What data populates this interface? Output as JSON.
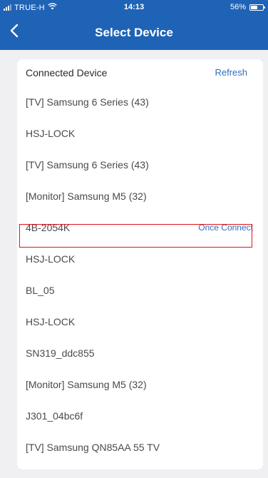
{
  "status_bar": {
    "carrier": "TRUE-H",
    "time": "14:13",
    "battery": "56%",
    "battery_level": 0.56,
    "signal_icon": "signal-icon",
    "wifi_icon": "wifi-icon",
    "battery_icon": "battery-icon"
  },
  "nav": {
    "title": "Select Device",
    "back_icon": "chevron-left-icon"
  },
  "card": {
    "title": "Connected Device",
    "refresh_label": "Refresh"
  },
  "devices": [
    {
      "name": "[TV] Samsung 6 Series (43)",
      "action": ""
    },
    {
      "name": "HSJ-LOCK",
      "action": ""
    },
    {
      "name": "[TV] Samsung 6 Series (43)",
      "action": ""
    },
    {
      "name": "[Monitor] Samsung M5 (32)",
      "action": ""
    },
    {
      "name": "4B-2054K",
      "action": "Once Connect"
    },
    {
      "name": "HSJ-LOCK",
      "action": ""
    },
    {
      "name": "BL_05",
      "action": ""
    },
    {
      "name": "HSJ-LOCK",
      "action": ""
    },
    {
      "name": "SN319_ddc855",
      "action": ""
    },
    {
      "name": "[Monitor] Samsung M5 (32)",
      "action": ""
    },
    {
      "name": "J301_04bc6f",
      "action": ""
    },
    {
      "name": "[TV] Samsung QN85AA 55 TV",
      "action": ""
    }
  ],
  "colors": {
    "header": "#1f63b6",
    "accent": "#2e6fc0",
    "highlight": "#e0141b",
    "background": "#f0f0f3"
  }
}
